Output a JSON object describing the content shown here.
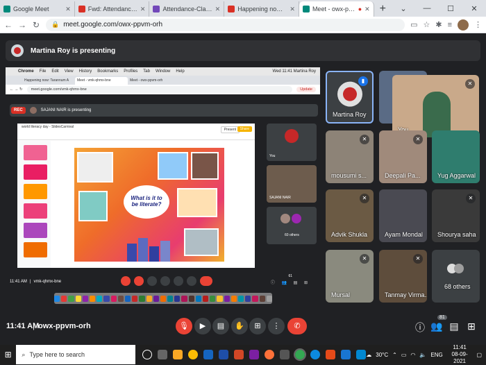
{
  "browser": {
    "tabs": [
      {
        "title": "Google Meet",
        "color": "#00897b",
        "active": false
      },
      {
        "title": "Fwd: Attendance Link for III -",
        "color": "#d93025",
        "active": false
      },
      {
        "title": "Attendance-Classes V TO VIII",
        "color": "#7248b9",
        "active": false
      },
      {
        "title": "Happening now: Martina Roy",
        "color": "#d93025",
        "active": false
      },
      {
        "title": "Meet - owx-ppvm-orh",
        "color": "#00897b",
        "active": true
      }
    ],
    "url": "meet.google.com/owx-ppvm-orh"
  },
  "meet": {
    "presenting_banner": "Martina Roy is presenting",
    "time": "11:41 AM",
    "meeting_code": "owx-ppvm-orh",
    "people_count": "81"
  },
  "shared_screen": {
    "mac_menu": [
      "Chrome",
      "File",
      "Edit",
      "View",
      "History",
      "Bookmarks",
      "Profiles",
      "Tab",
      "Window",
      "Help"
    ],
    "mac_status": "Wed 11:41  Martina Roy",
    "tabs": [
      "Happening now: Tarannum A",
      "Meet - vmk-qhmx-bne",
      "Meet - owx-ppvm-orh"
    ],
    "url": "meet.google.com/vmk-qhmx-bne",
    "update_label": "Update",
    "rec_label": "REC",
    "presenting_text": "SAJANI NAIR is presenting",
    "slides_title": "world literacy day - SlidesCarnival",
    "present_label": "Present",
    "share_label": "Share",
    "slide_question": "What is it to be literate?",
    "tiles": [
      {
        "name": "You"
      },
      {
        "name": "SAJANI NAIR"
      },
      {
        "name": "60 others"
      }
    ],
    "time": "11:41 AM",
    "code": "vmk-qhmx-bne",
    "people_count": "61"
  },
  "participants": [
    {
      "name": "Martina Roy",
      "status": "speaking"
    },
    {
      "name": "",
      "status": "muted"
    },
    {
      "name": "You",
      "status": "muted"
    },
    {
      "name": "mousumi s...",
      "status": "muted"
    },
    {
      "name": "Deepali Pa...",
      "status": "muted"
    },
    {
      "name": "Yug Aggarwal",
      "status": "muted"
    },
    {
      "name": "Advik Shukla",
      "status": "muted"
    },
    {
      "name": "Ayam Mondal",
      "status": "muted"
    },
    {
      "name": "Shourya saha",
      "status": "muted"
    },
    {
      "name": "Mursal",
      "status": "muted"
    },
    {
      "name": "Tanmay Virma...",
      "status": "muted"
    },
    {
      "name": "68 others",
      "status": "none"
    }
  ],
  "taskbar": {
    "search_placeholder": "Type here to search",
    "weather": "30°C",
    "lang": "ENG",
    "time": "11:41",
    "date": "08-09-2021"
  }
}
